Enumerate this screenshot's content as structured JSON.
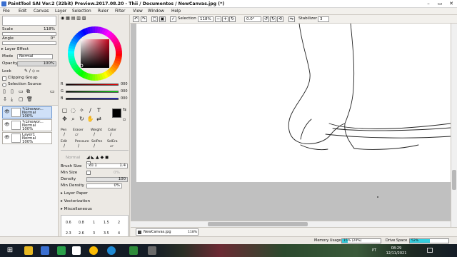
{
  "window": {
    "title": "PaintTool SAI Ver.2 (32bit) Preview.2017.08.20 - Thii / Documentos / NewCanvas.jpg (*)"
  },
  "menubar": [
    "File",
    "Edit",
    "Canvas",
    "Layer",
    "Selection",
    "Ruler",
    "Filter",
    "View",
    "Window",
    "Help"
  ],
  "tool_options": {
    "selection_label": "Selection",
    "zoom": "118%",
    "rotation": "0.0°",
    "stabilizer_label": "Stabilizer",
    "stabilizer_value": "3"
  },
  "left_panel": {
    "scale_label": "Scale",
    "scale_value": "118%",
    "angle_label": "Angle",
    "angle_value": "0°",
    "layer_effect": "Layer Effect",
    "mode_label": "Mode",
    "mode_value": "Normal",
    "opacity_label": "Opacity",
    "opacity_value": "100%",
    "lock_label": "Lock",
    "clipping_group": "Clipping Group",
    "selection_source": "Selection Source",
    "layers": [
      {
        "name": "Linewor...",
        "mode": "Normal",
        "opacity": "100%",
        "selected": true
      },
      {
        "name": "Linewor...",
        "mode": "Normal",
        "opacity": "100%",
        "selected": false
      },
      {
        "name": "Layer1",
        "mode": "Normal",
        "opacity": "100%",
        "selected": false
      }
    ]
  },
  "color_panel": {
    "selected_color": "#5a0a10",
    "r_label": "R",
    "r_value": "000",
    "g_label": "G",
    "g_value": "000",
    "b_label": "B",
    "b_value": "000",
    "current_color": "#000000"
  },
  "tool_panel": {
    "brush_row1": [
      "Pen",
      "Eraser",
      "Weight",
      "Color"
    ],
    "brush_row2": [
      "Edit",
      "Pressure",
      "SelPen",
      "SelEra"
    ],
    "blend_label": "Normal",
    "brush_size_label": "Brush Size",
    "brush_size_mult": "x0.1",
    "brush_size_value": "1.4",
    "min_size_label": "Min Size",
    "min_size_value": "0%",
    "density_label": "Density",
    "density_value": "100",
    "min_density_label": "Min Density",
    "min_density_value": "0%",
    "layer_paper": "Layer Paper",
    "vectorization": "Vectorization",
    "miscellaneous": "Miscellaneous",
    "presets_row1": [
      "0.6",
      "0.8",
      "1",
      "1.5",
      "2"
    ],
    "presets_row2": [
      "2.3",
      "2.6",
      "3",
      "3.5",
      "4"
    ],
    "presets_partial": [
      "",
      "",
      "",
      "",
      ""
    ]
  },
  "navigator": {
    "tab_label": "NewCanvas.jpg",
    "zoom": "118%"
  },
  "statusbar": {
    "memory_label": "Memory Usage",
    "memory_value": "15% (24%)",
    "memory_fill": 0.15,
    "drive_label": "Drive Space",
    "drive_value": "52%",
    "drive_fill": 0.52
  },
  "taskbar": {
    "time": "08:29",
    "date": "12/11/2021",
    "lang": "PT"
  },
  "colors": {
    "accent": "#3a6fd0",
    "meter_fill": "#35d0e0",
    "taskbar": "#141c26"
  }
}
